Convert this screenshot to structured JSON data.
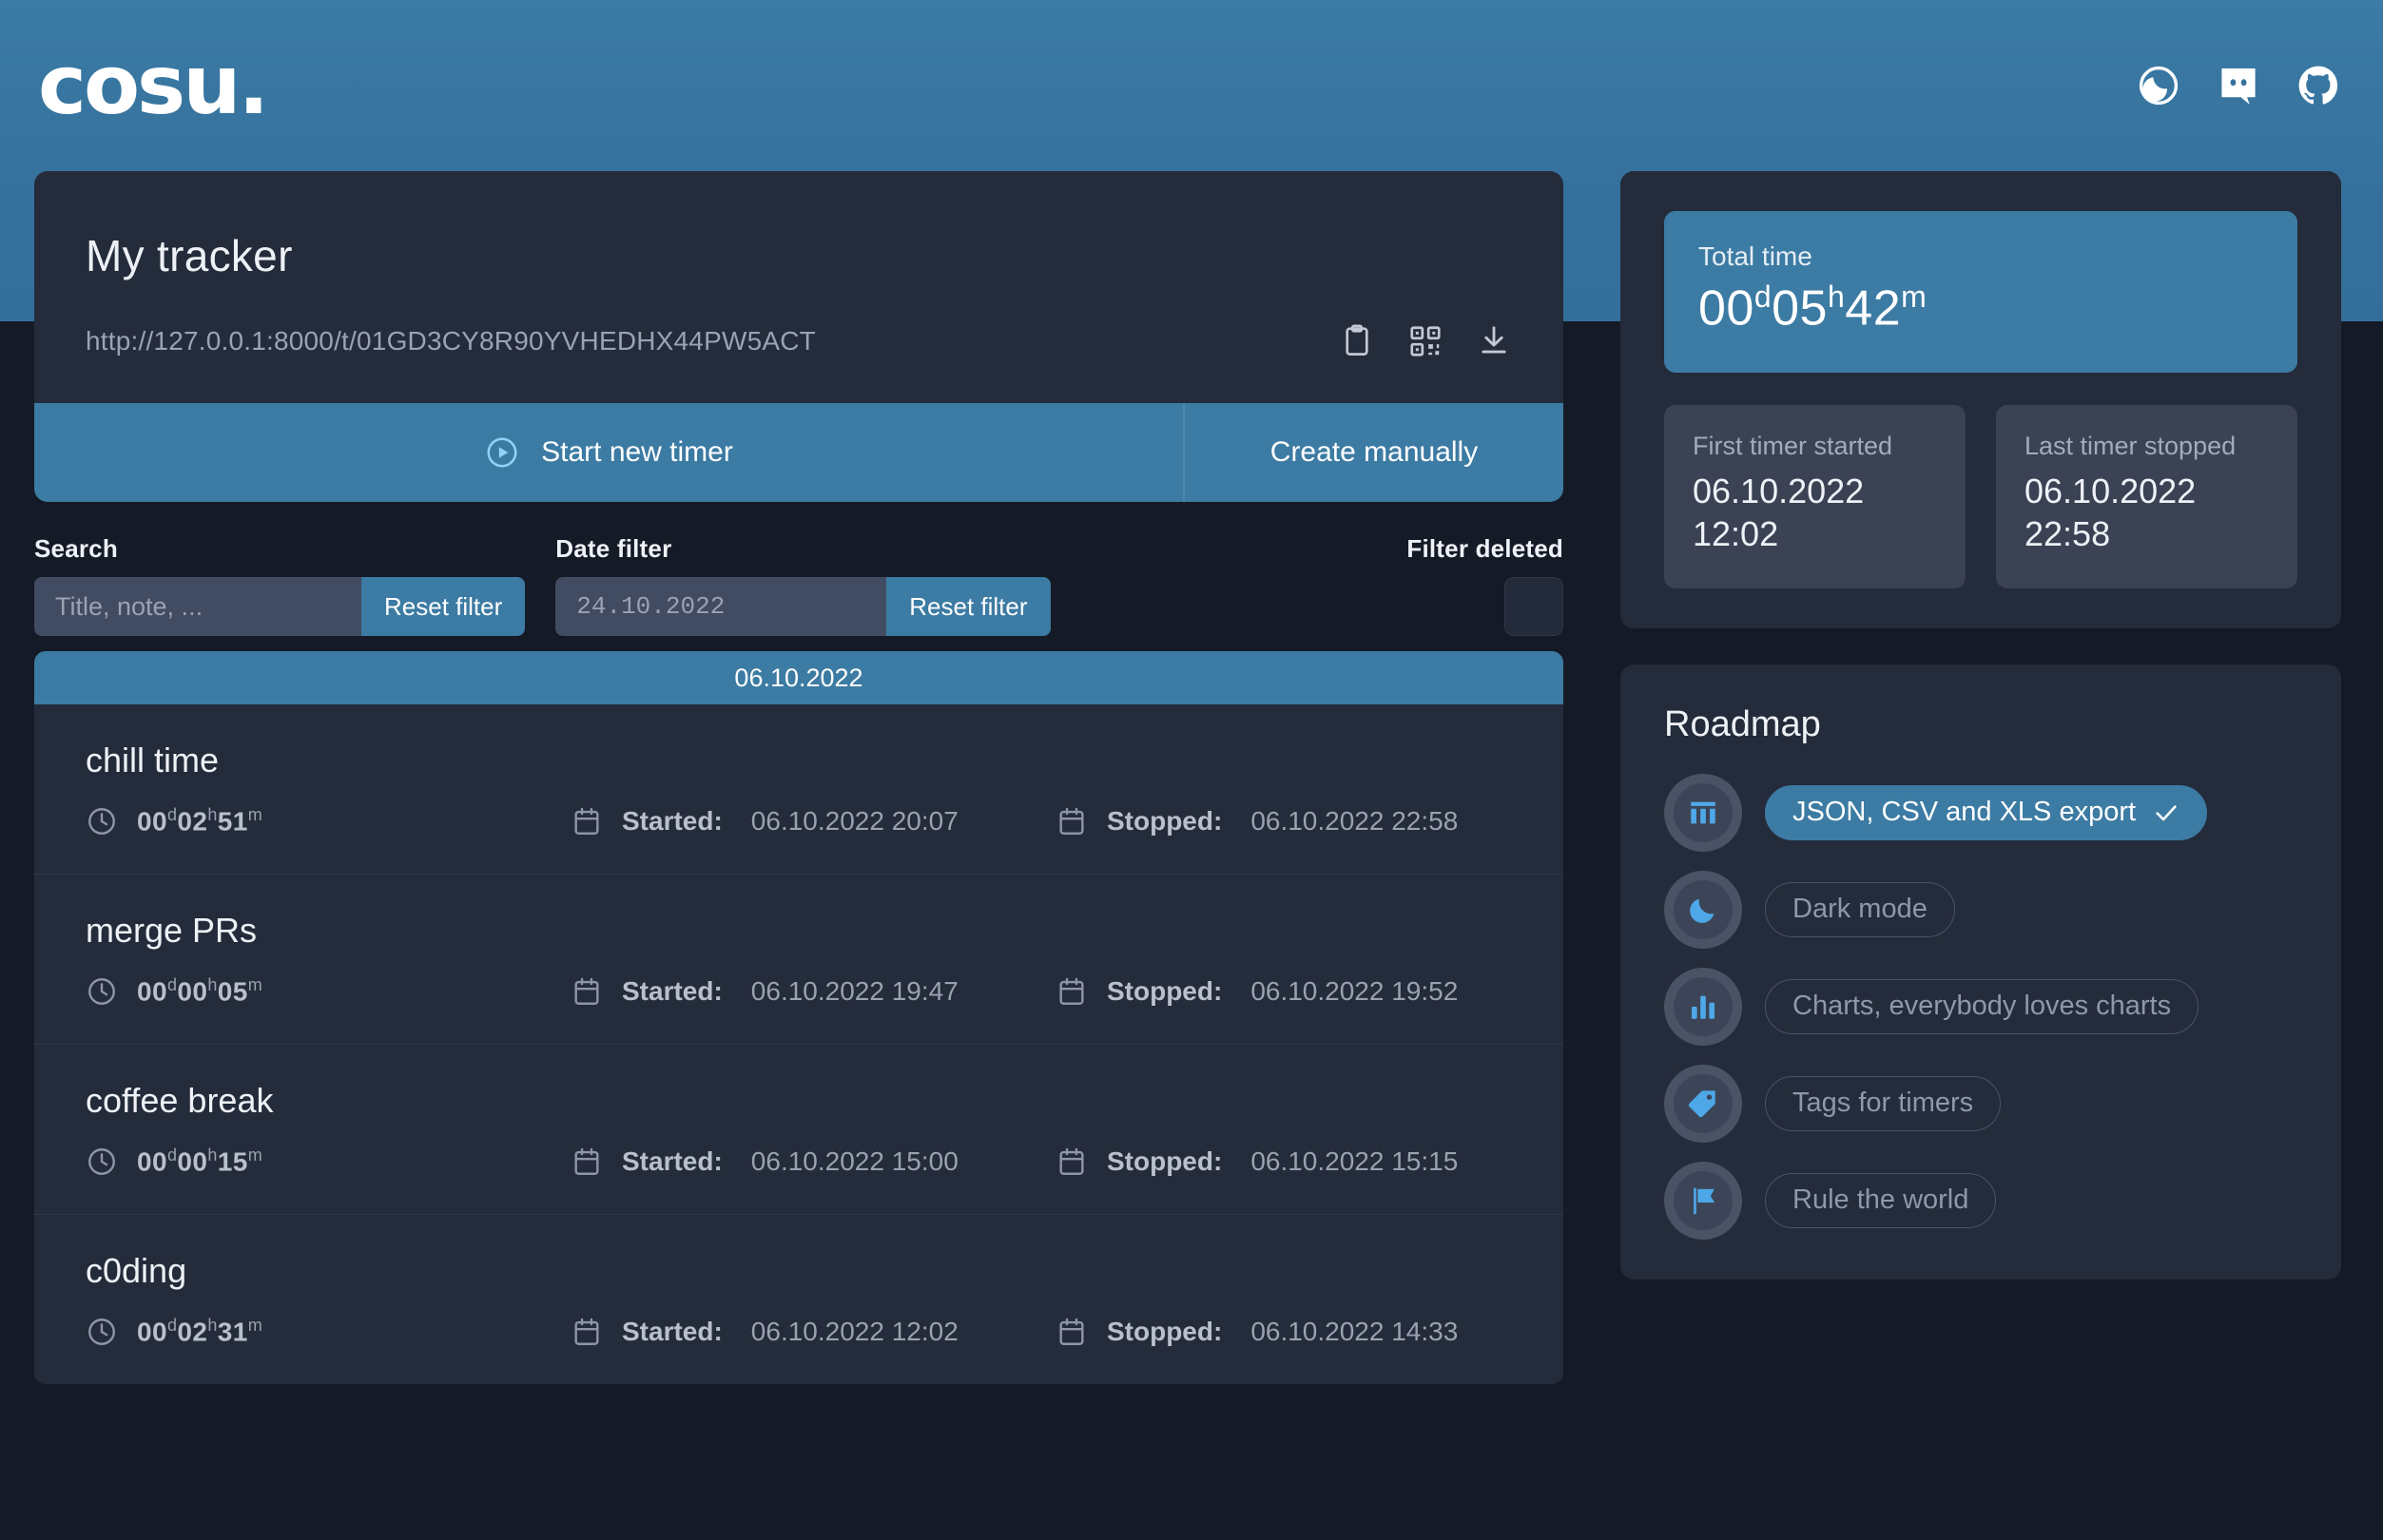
{
  "header": {
    "logo": "cosu.",
    "icons": [
      {
        "name": "dark-mode-toggle",
        "label": "Dark mode"
      },
      {
        "name": "discord-link",
        "label": "Discord"
      },
      {
        "name": "github-link",
        "label": "GitHub"
      }
    ]
  },
  "tracker": {
    "title": "My tracker",
    "url": "http://127.0.0.1:8000/t/01GD3CY8R90YVHEDHX44PW5ACT",
    "actions": [
      {
        "name": "copy-link-icon",
        "label": "Copy link"
      },
      {
        "name": "qr-code-icon",
        "label": "QR code"
      },
      {
        "name": "download-icon",
        "label": "Download"
      }
    ],
    "start_button": "Start new timer",
    "create_button": "Create manually"
  },
  "filters": {
    "search_label": "Search",
    "search_value": "",
    "search_placeholder": "Title, note, ...",
    "search_reset": "Reset filter",
    "date_label": "Date filter",
    "date_value": "",
    "date_placeholder": "24.10.2022",
    "date_reset": "Reset filter",
    "filter_deleted_label": "Filter deleted",
    "filter_deleted_checked": false
  },
  "timer_list": {
    "date_band": "06.10.2022",
    "started_label": "Started:",
    "stopped_label": "Stopped:",
    "rows": [
      {
        "name": "chill time",
        "duration_d": "00",
        "duration_h": "02",
        "duration_m": "51",
        "started": "06.10.2022 20:07",
        "stopped": "06.10.2022 22:58"
      },
      {
        "name": "merge PRs",
        "duration_d": "00",
        "duration_h": "00",
        "duration_m": "05",
        "started": "06.10.2022 19:47",
        "stopped": "06.10.2022 19:52"
      },
      {
        "name": "coffee break",
        "duration_d": "00",
        "duration_h": "00",
        "duration_m": "15",
        "started": "06.10.2022 15:00",
        "stopped": "06.10.2022 15:15"
      },
      {
        "name": "c0ding",
        "duration_d": "00",
        "duration_h": "02",
        "duration_m": "31",
        "started": "06.10.2022 12:02",
        "stopped": "06.10.2022 14:33"
      }
    ]
  },
  "stats": {
    "total_label": "Total time",
    "total_d": "00",
    "total_h": "05",
    "total_m": "42",
    "first_label": "First timer started",
    "first_date": "06.10.2022",
    "first_time": "12:02",
    "last_label": "Last timer stopped",
    "last_date": "06.10.2022",
    "last_time": "22:58"
  },
  "roadmap": {
    "title": "Roadmap",
    "items": [
      {
        "icon": "table-columns-icon",
        "label": "JSON, CSV and XLS export",
        "done": true
      },
      {
        "icon": "moon-icon",
        "label": "Dark mode",
        "done": false
      },
      {
        "icon": "bar-chart-icon",
        "label": "Charts, everybody loves charts",
        "done": false
      },
      {
        "icon": "tag-icon",
        "label": "Tags for timers",
        "done": false
      },
      {
        "icon": "flag-icon",
        "label": "Rule the world",
        "done": false
      }
    ]
  },
  "colors": {
    "accent": "#3c7ba3",
    "accent_light": "#4ea8e8",
    "panel": "#242b3a",
    "page_dark": "#151a27"
  }
}
